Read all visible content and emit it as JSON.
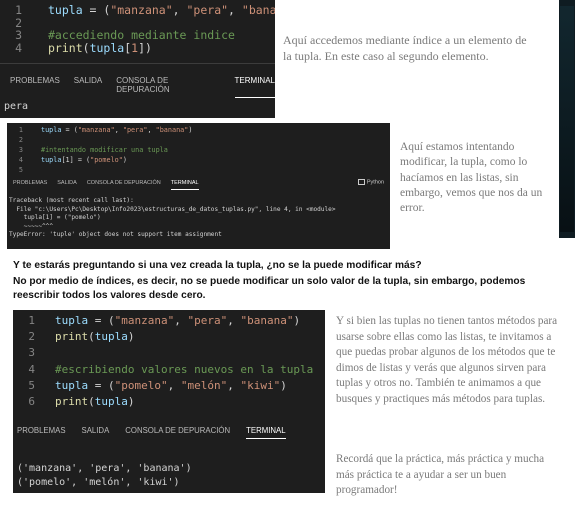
{
  "panel1": {
    "code": [
      {
        "n": "1",
        "parts": [
          [
            "var",
            "tupla"
          ],
          [
            "op",
            " = ("
          ],
          [
            "str",
            "\"manzana\""
          ],
          [
            "op",
            ", "
          ],
          [
            "str",
            "\"pera\""
          ],
          [
            "op",
            ", "
          ],
          [
            "str",
            "\"banana\""
          ],
          [
            "op",
            ")"
          ]
        ]
      },
      {
        "n": "2",
        "parts": []
      },
      {
        "n": "3",
        "parts": [
          [
            "cm",
            "#accediendo mediante indice"
          ]
        ]
      },
      {
        "n": "4",
        "parts": [
          [
            "fn",
            "print"
          ],
          [
            "op",
            "("
          ],
          [
            "var",
            "tupla"
          ],
          [
            "op",
            "["
          ],
          [
            "str",
            "1"
          ],
          [
            "op",
            "])"
          ]
        ]
      }
    ],
    "tabs": [
      "PROBLEMAS",
      "SALIDA",
      "CONSOLA DE DEPURACIÓN",
      "TERMINAL"
    ],
    "active_tab": "TERMINAL",
    "output": "pera"
  },
  "caption1": "Aquí accedemos mediante índice a un elemento de la tupla. En este caso al segundo elemento.",
  "panel2": {
    "code": [
      {
        "n": "1",
        "parts": [
          [
            "var",
            "tupla"
          ],
          [
            "op",
            " = ("
          ],
          [
            "str",
            "\"manzana\""
          ],
          [
            "op",
            ", "
          ],
          [
            "str",
            "\"pera\""
          ],
          [
            "op",
            ", "
          ],
          [
            "str",
            "\"banana\""
          ],
          [
            "op",
            ")"
          ]
        ]
      },
      {
        "n": "2",
        "parts": []
      },
      {
        "n": "3",
        "parts": [
          [
            "cm",
            "#intentando modificar una tupla"
          ]
        ]
      },
      {
        "n": "4",
        "parts": [
          [
            "var",
            "tupla"
          ],
          [
            "op",
            "[1] = ("
          ],
          [
            "str",
            "\"pomelo\""
          ],
          [
            "op",
            ")"
          ]
        ]
      },
      {
        "n": "5",
        "parts": []
      }
    ],
    "tabs": [
      "PROBLEMAS",
      "SALIDA",
      "CONSOLA DE DEPURACIÓN",
      "TERMINAL"
    ],
    "active_tab": "TERMINAL",
    "python_label": "Python",
    "traceback": [
      "Traceback (most recent call last):",
      "  File \"c:\\Users\\Pc\\Desktop\\Info2023\\estructuras_de_datos_tuplas.py\", line 4, in <module>",
      "    tupla[1] = (\"pomelo\")",
      "    ~~~~~^^^",
      "TypeError: 'tuple' object does not support item assignment"
    ]
  },
  "caption2": "Aquí estamos intentando modificar, la tupla, como lo hacíamos en las listas, sin embargo, vemos que nos da un error.",
  "question": "Y te estarás preguntando si una vez creada la tupla, ¿no se la puede modificar más?",
  "answer": "No por medio de índices, es decir, no se puede modificar un solo valor de la tupla, sin embargo, podemos reescribir todos los valores desde cero.",
  "panel3": {
    "code": [
      {
        "n": "1",
        "parts": [
          [
            "var",
            "tupla"
          ],
          [
            "op",
            " = ("
          ],
          [
            "str",
            "\"manzana\""
          ],
          [
            "op",
            ", "
          ],
          [
            "str",
            "\"pera\""
          ],
          [
            "op",
            ", "
          ],
          [
            "str",
            "\"banana\""
          ],
          [
            "op",
            ")"
          ]
        ]
      },
      {
        "n": "2",
        "parts": [
          [
            "fn",
            "print"
          ],
          [
            "op",
            "("
          ],
          [
            "var",
            "tupla"
          ],
          [
            "op",
            ")"
          ]
        ]
      },
      {
        "n": "3",
        "parts": []
      },
      {
        "n": "4",
        "parts": [
          [
            "cm",
            "#escribiendo valores nuevos en la tupla"
          ]
        ]
      },
      {
        "n": "5",
        "parts": [
          [
            "var",
            "tupla"
          ],
          [
            "op",
            " = ("
          ],
          [
            "str",
            "\"pomelo\""
          ],
          [
            "op",
            ", "
          ],
          [
            "str",
            "\"melón\""
          ],
          [
            "op",
            ", "
          ],
          [
            "str",
            "\"kiwi\""
          ],
          [
            "op",
            ")"
          ]
        ]
      },
      {
        "n": "6",
        "parts": [
          [
            "fn",
            "print"
          ],
          [
            "op",
            "("
          ],
          [
            "var",
            "tupla"
          ],
          [
            "op",
            ")"
          ]
        ]
      }
    ],
    "tabs": [
      "PROBLEMAS",
      "SALIDA",
      "CONSOLA DE DEPURACIÓN",
      "TERMINAL"
    ],
    "active_tab": "TERMINAL",
    "output": [
      "('manzana', 'pera', 'banana')",
      "('pomelo', 'melón', 'kiwi')"
    ]
  },
  "caption3": "Y si bien las tuplas no tienen tantos métodos para usarse sobre ellas como las listas, te invitamos a que puedas probar algunos de los métodos que te dimos de listas y verás que algunos sirven para tuplas y otros no. También te animamos a que busques y practiques más métodos para tuplas.",
  "caption4": "Recordá que la práctica, más práctica y mucha más práctica te a ayudar a ser un buen programador!"
}
